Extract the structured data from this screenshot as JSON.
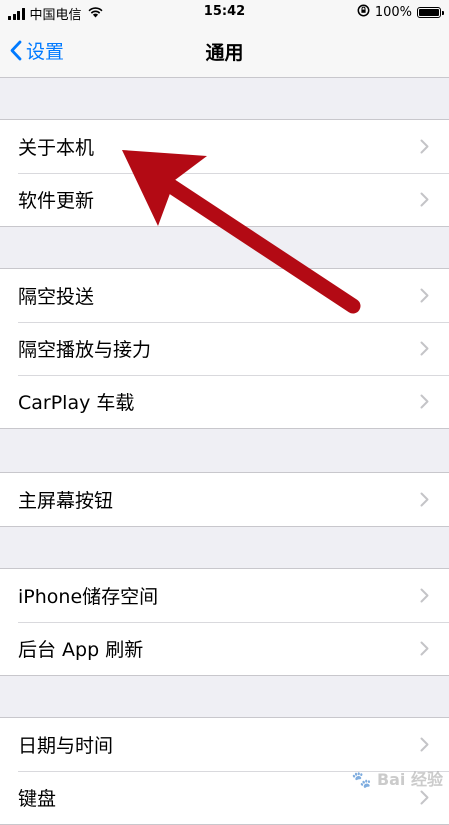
{
  "status_bar": {
    "carrier": "中国电信",
    "time": "15:42",
    "battery": "100%",
    "battery_level": 1.0
  },
  "nav": {
    "back_label": "设置",
    "title": "通用"
  },
  "groups": [
    {
      "rows": [
        {
          "label": "关于本机"
        },
        {
          "label": "软件更新"
        }
      ]
    },
    {
      "rows": [
        {
          "label": "隔空投送"
        },
        {
          "label": "隔空播放与接力"
        },
        {
          "label": "CarPlay 车载"
        }
      ]
    },
    {
      "rows": [
        {
          "label": "主屏幕按钮"
        }
      ]
    },
    {
      "rows": [
        {
          "label": "iPhone储存空间"
        },
        {
          "label": "后台 App 刷新"
        }
      ]
    },
    {
      "rows": [
        {
          "label": "日期与时间"
        },
        {
          "label": "键盘"
        }
      ]
    }
  ],
  "watermark": {
    "text": "Bai 经验"
  },
  "colors": {
    "accent": "#007aff",
    "annotation_arrow": "#b30a14",
    "background": "#efeff4"
  }
}
